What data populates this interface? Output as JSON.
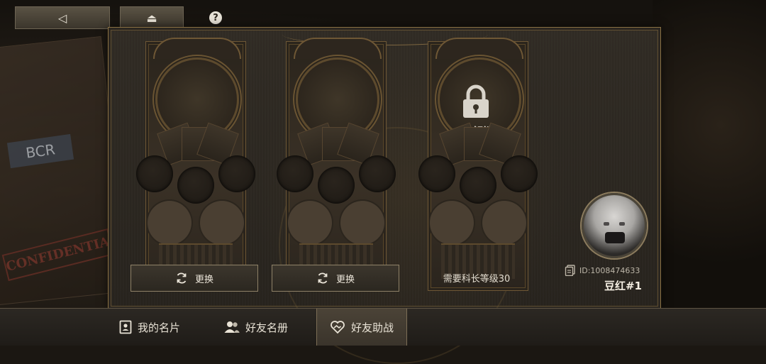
{
  "nav": {
    "back_glyph": "◁",
    "home_glyph": "⏏",
    "help_glyph": "?"
  },
  "cards": [
    {
      "state": "empty",
      "button_label": "更换"
    },
    {
      "state": "empty",
      "button_label": "更换"
    },
    {
      "state": "locked",
      "lock_label": "未解锁",
      "requirement": "需要科长等级30"
    }
  ],
  "profile": {
    "id_text": "ID:1008474633",
    "name": "豆红#1"
  },
  "tabs": [
    {
      "label": "我的名片",
      "icon": "id-card-icon",
      "active": false
    },
    {
      "label": "好友名册",
      "icon": "friends-icon",
      "active": false
    },
    {
      "label": "好友助战",
      "icon": "heart-handshake-icon",
      "active": true
    }
  ],
  "colors": {
    "accent_gold": "#8a7143",
    "panel_bg": "#2b2620"
  }
}
